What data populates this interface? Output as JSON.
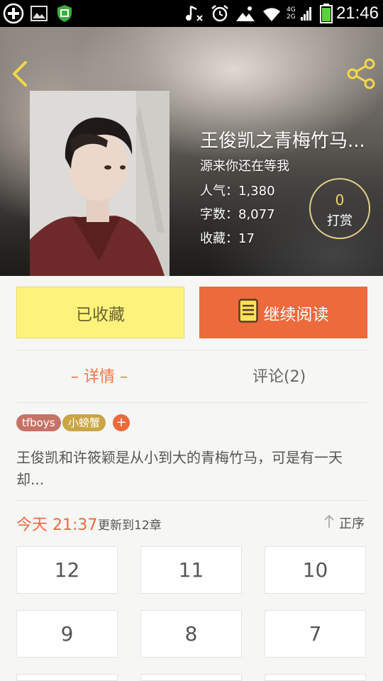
{
  "status_bar": {
    "time": "21:46",
    "network_label_top": "4G",
    "network_label_bottom": "2G",
    "icons": [
      "plus-circle-icon",
      "gallery-icon",
      "shield-icon",
      "music-muted-icon",
      "alarm-icon",
      "weather-icon",
      "wifi-icon",
      "signal-icon",
      "battery-icon"
    ]
  },
  "header": {
    "back_icon": "chevron-left-icon",
    "share_icon": "share-icon"
  },
  "book": {
    "title": "王俊凯之青梅竹马...",
    "subtitle": "源来你还在等我",
    "popularity": "人气：1,380",
    "word_count": "字数：8,077",
    "favorites": "收藏：17",
    "reward_count": "0",
    "reward_label": "打赏"
  },
  "actions": {
    "favorite_label": "已收藏",
    "read_label": "继续阅读"
  },
  "tabs": {
    "detail": "– 详情 –",
    "comments": "评论(2)"
  },
  "tags": [
    "tfboys",
    "小螃蟹",
    "+"
  ],
  "description": "王俊凯和许筱颖是从小到大的青梅竹马，可是有一天却...",
  "update": {
    "time": "今天 21:37",
    "text": "更新到12章",
    "sort_label": "正序"
  },
  "chapters": [
    "12",
    "11",
    "10",
    "9",
    "8",
    "7"
  ],
  "colors": {
    "accent": "#ec6a3c",
    "favorite_bg": "#fdf37c",
    "tag_1": "#c57366",
    "tag_2": "#c9a544",
    "reward_ring": "#e2cf8c"
  }
}
